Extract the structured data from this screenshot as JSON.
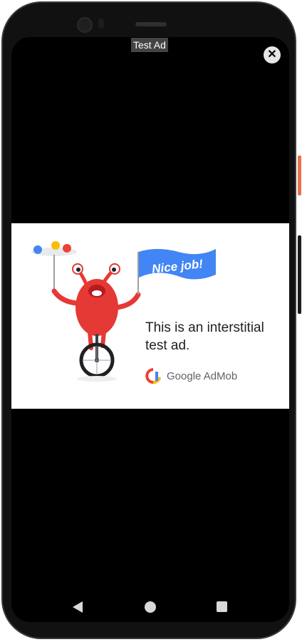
{
  "ad": {
    "badge": "Test Ad",
    "flag_text": "Nice job!",
    "headline": "This is an interstitial test ad.",
    "brand": "Google AdMob"
  },
  "colors": {
    "frame": "#111111",
    "screen": "#000000",
    "flag_blue": "#4285f4",
    "monster_red": "#e53935"
  },
  "icons": {
    "close": "close-icon",
    "back": "nav-back-icon",
    "home": "nav-home-icon",
    "recent": "nav-recents-icon"
  }
}
